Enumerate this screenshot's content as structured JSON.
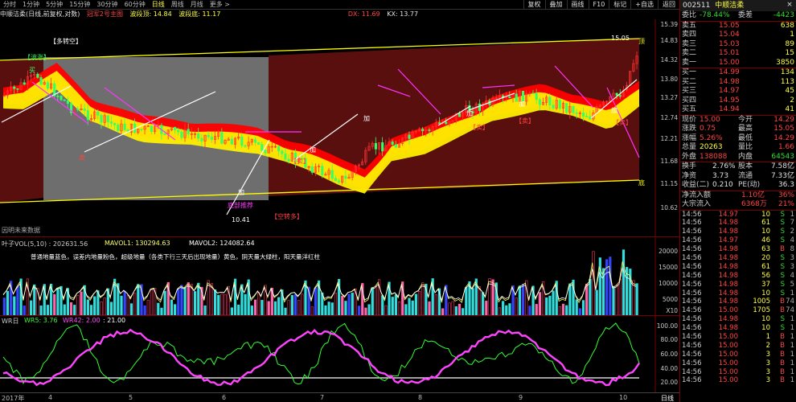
{
  "toolbar": {
    "periods": [
      "分时",
      "1分钟",
      "5分钟",
      "15分钟",
      "30分钟",
      "60分钟",
      "日线",
      "周线",
      "月线",
      "更多 >"
    ],
    "active_period": "日线",
    "buttons": [
      "复权",
      "叠加",
      "画线",
      "F10",
      "标记",
      "+自选",
      "返回"
    ]
  },
  "info": {
    "title": "中顺洁柔(日线,前复权,对数)",
    "champion": "冠军2号主图",
    "band_top": "波段顶: 14.84",
    "band_bottom": "波段底: 11.17",
    "dx": "DX: 11.69",
    "kx": "KX: 13.77"
  },
  "main_chart": {
    "price_labels": [
      "15.39",
      "14.83",
      "14.32",
      "13.80",
      "13.27",
      "12.74",
      "12.21",
      "11.68",
      "11.15",
      "10.62"
    ],
    "annotations": {
      "duo_kong": "【多转空】",
      "bo_zhang": "【波涨】",
      "buy": "买",
      "add": "加",
      "sell": "【卖】",
      "sell_short": "卖",
      "kong_duo": "【空转多】",
      "bottom_sign": "底部推荐",
      "low_price": "10.41",
      "high_price": "15.05",
      "ding": "顶",
      "di": "底",
      "future_data": "因明未来数据"
    },
    "colors": {
      "up_candle": "#ff3333",
      "down_candle": "#33ff66",
      "channel": "#ffff00",
      "trend_white": "#ffffff",
      "trend_magenta": "#ff33ff"
    }
  },
  "volume": {
    "title": "叶子VOL(5,10) : 202631.56",
    "mavol1": "MAVOL1: 130294.63",
    "mavol2": "MAVOL2: 124082.64",
    "note": "普通地量蓝色，误差内地量粉色，超级地量（各类下行三天后出现地量）黄色，阴天量大绿柱，阳天量洋红柱",
    "axis": [
      "20000",
      "15000",
      "10000",
      "5000",
      "X10"
    ]
  },
  "wr": {
    "title": "WR日",
    "wr5": "WR5: 3.76",
    "wr42": "WR42: 2.00",
    "level": ": 21.00",
    "axis": [
      "100.00",
      "80.00",
      "60.00",
      "40.00",
      "20.00"
    ]
  },
  "time_axis": {
    "labels": [
      "2017年",
      "4",
      "5",
      "6",
      "7",
      "8",
      "9",
      "10"
    ],
    "right_label": "日线"
  },
  "quote": {
    "code": "002511",
    "name": "中顺洁柔",
    "weibi_label": "委比",
    "weibi": "-78.44%",
    "weicha_label": "委差",
    "weicha": "-4423",
    "asks": [
      {
        "label": "卖五",
        "price": "15.05",
        "vol": "638"
      },
      {
        "label": "卖四",
        "price": "15.04",
        "vol": "1"
      },
      {
        "label": "卖三",
        "price": "15.03",
        "vol": "89"
      },
      {
        "label": "卖二",
        "price": "15.01",
        "vol": "15"
      },
      {
        "label": "卖一",
        "price": "15.00",
        "vol": "3850"
      }
    ],
    "bids": [
      {
        "label": "买一",
        "price": "14.99",
        "vol": "134"
      },
      {
        "label": "买二",
        "price": "14.98",
        "vol": "113"
      },
      {
        "label": "买三",
        "price": "14.97",
        "vol": "45"
      },
      {
        "label": "买四",
        "price": "14.95",
        "vol": "2"
      },
      {
        "label": "买五",
        "price": "14.94",
        "vol": "41"
      }
    ],
    "stats": [
      {
        "l1": "现价",
        "v1": "15.00",
        "l2": "今开",
        "v2": "14.29",
        "c1": "red",
        "c2": "red"
      },
      {
        "l1": "涨跌",
        "v1": "0.75",
        "l2": "最高",
        "v2": "15.05",
        "c1": "red",
        "c2": "red"
      },
      {
        "l1": "涨幅",
        "v1": "5.26%",
        "l2": "最低",
        "v2": "14.29",
        "c1": "red",
        "c2": "red"
      },
      {
        "l1": "总量",
        "v1": "20263",
        "l2": "量比",
        "v2": "1.66",
        "c1": "yellow",
        "c2": "red"
      },
      {
        "l1": "外盘",
        "v1": "138088",
        "l2": "内盘",
        "v2": "64543",
        "c1": "red",
        "c2": "green"
      }
    ],
    "stats2": [
      {
        "l1": "换手",
        "v1": "2.76%",
        "l2": "股本",
        "v2": "7.58亿"
      },
      {
        "l1": "净资",
        "v1": "3.73",
        "l2": "流通",
        "v2": "7.33亿"
      },
      {
        "l1": "收益(二)",
        "v1": "0.210",
        "l2": "PE(动)",
        "v2": "36.3"
      }
    ],
    "flow": [
      {
        "label": "净流入额",
        "value": "1.10亿",
        "pct": "36%"
      },
      {
        "label": "大宗流入",
        "value": "6368万",
        "pct": "21%"
      }
    ],
    "ticks": [
      {
        "time": "14:56",
        "price": "14.97",
        "vol": "10",
        "bs": "S",
        "q": "1"
      },
      {
        "time": "14:56",
        "price": "14.98",
        "vol": "61",
        "bs": "S",
        "q": "7"
      },
      {
        "time": "14:56",
        "price": "14.98",
        "vol": "10",
        "bs": "S",
        "q": "2"
      },
      {
        "time": "14:56",
        "price": "14.97",
        "vol": "46",
        "bs": "S",
        "q": "4"
      },
      {
        "time": "14:56",
        "price": "14.98",
        "vol": "63",
        "bs": "B",
        "q": "8"
      },
      {
        "time": "14:56",
        "price": "14.98",
        "vol": "20",
        "bs": "S",
        "q": "3"
      },
      {
        "time": "14:56",
        "price": "14.98",
        "vol": "61",
        "bs": "S",
        "q": "3"
      },
      {
        "time": "14:56",
        "price": "14.98",
        "vol": "56",
        "bs": "S",
        "q": "4"
      },
      {
        "time": "14:56",
        "price": "14.98",
        "vol": "37",
        "bs": "S",
        "q": "5"
      },
      {
        "time": "14:56",
        "price": "14.98",
        "vol": "10",
        "bs": "S",
        "q": "1"
      },
      {
        "time": "14:56",
        "price": "14.98",
        "vol": "1005",
        "bs": "B",
        "q": "74"
      },
      {
        "time": "14:56",
        "price": "15.00",
        "vol": "1705",
        "bs": "B",
        "q": "74"
      },
      {
        "time": "14:56",
        "price": "14.98",
        "vol": "10",
        "bs": "S",
        "q": "1"
      },
      {
        "time": "14:56",
        "price": "14.98",
        "vol": "10",
        "bs": "S",
        "q": "1"
      },
      {
        "time": "14:56",
        "price": "15.00",
        "vol": "1",
        "bs": "B",
        "q": "1"
      },
      {
        "time": "14:56",
        "price": "15.00",
        "vol": "2",
        "bs": "B",
        "q": "1"
      },
      {
        "time": "14:56",
        "price": "15.00",
        "vol": "3",
        "bs": "B",
        "q": "1"
      },
      {
        "time": "14:56",
        "price": "15.00",
        "vol": "3",
        "bs": "B",
        "q": "1"
      },
      {
        "time": "14:56",
        "price": "15.00",
        "vol": "3",
        "bs": "B",
        "q": "1"
      },
      {
        "time": "14:56",
        "price": "15.00",
        "vol": "3",
        "bs": "B",
        "q": "1"
      }
    ]
  }
}
